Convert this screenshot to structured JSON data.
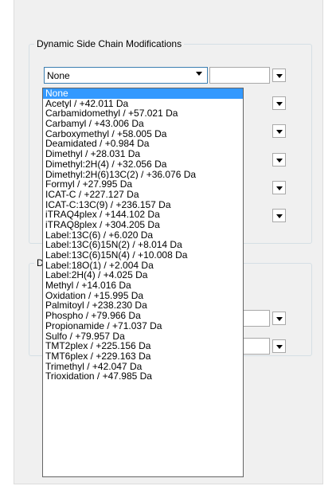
{
  "group1": {
    "title": "Dynamic Side Chain Modifications"
  },
  "group2": {
    "title": "D"
  },
  "modification_select": {
    "value": "None"
  },
  "options": [
    "None",
    "Acetyl / +42.011 Da",
    "Carbamidomethyl / +57.021 Da",
    "Carbamyl / +43.006 Da",
    "Carboxymethyl / +58.005 Da",
    "Deamidated / +0.984 Da",
    "Dimethyl / +28.031 Da",
    "Dimethyl:2H(4) / +32.056 Da",
    "Dimethyl:2H(6)13C(2) / +36.076 Da",
    "Formyl / +27.995 Da",
    "ICAT-C / +227.127 Da",
    "ICAT-C:13C(9) / +236.157 Da",
    "iTRAQ4plex / +144.102 Da",
    "iTRAQ8plex / +304.205 Da",
    "Label:13C(6) / +6.020 Da",
    "Label:13C(6)15N(2) / +8.014 Da",
    "Label:13C(6)15N(4) / +10.008 Da",
    "Label:18O(1) / +2.004 Da",
    "Label:2H(4) / +4.025 Da",
    "Methyl / +14.016 Da",
    "Oxidation / +15.995 Da",
    "Palmitoyl / +238.230 Da",
    "Phospho / +79.966 Da",
    "Propionamide / +71.037 Da",
    "Sulfo / +79.957 Da",
    "TMT2plex / +225.156 Da",
    "TMT6plex / +229.163 Da",
    "Trimethyl / +42.047 Da",
    "Trioxidation / +47.985 Da"
  ],
  "selected_index": 0,
  "colors": {
    "selection": "#3399ff",
    "combo_border_active": "#3c7fb1"
  }
}
